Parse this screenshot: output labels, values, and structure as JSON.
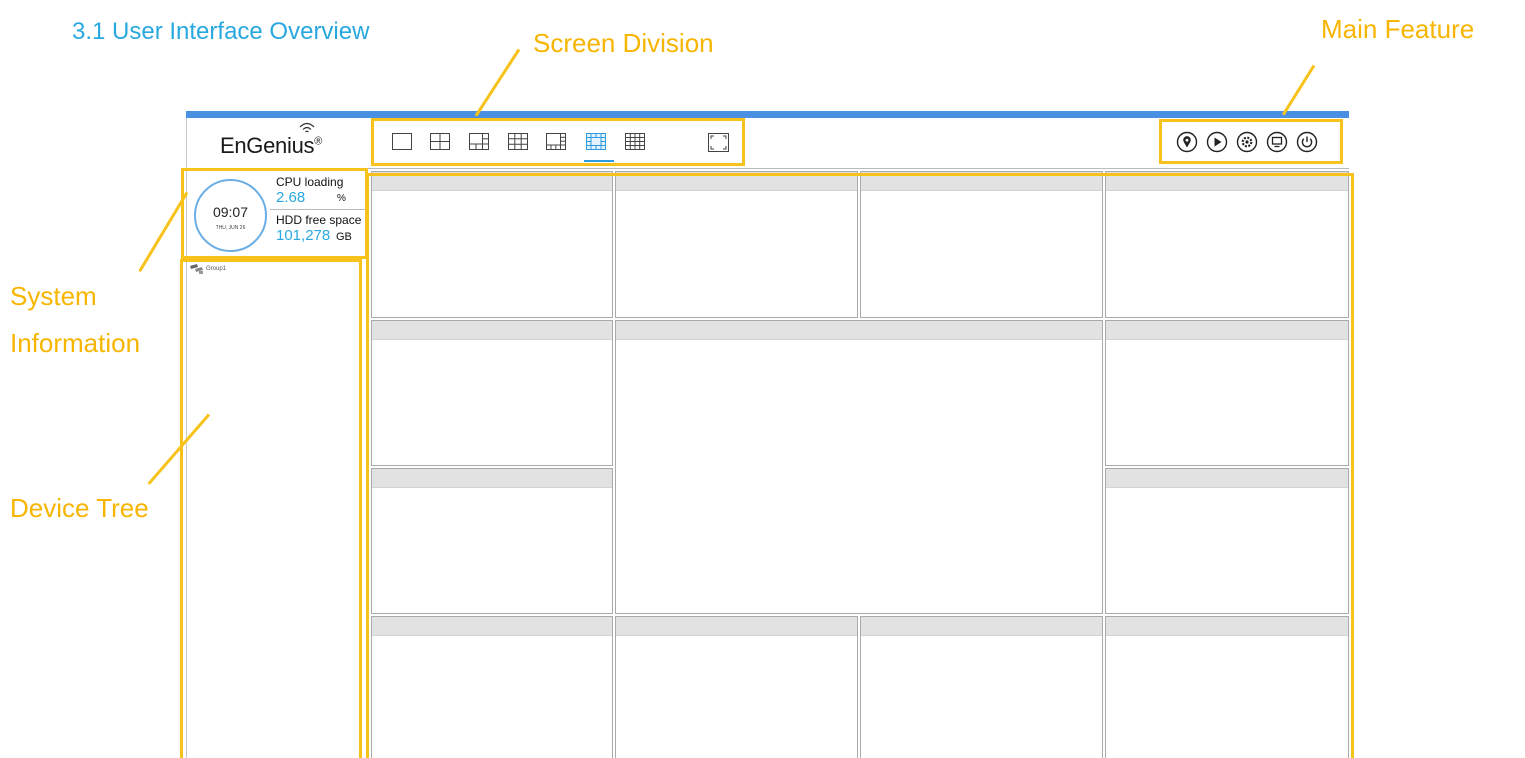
{
  "document": {
    "title": "3.1 User Interface Overview"
  },
  "annotations": {
    "screen_division": "Screen Division",
    "main_feature": "Main Feature",
    "system_information_line1": "System",
    "system_information_line2": "Information",
    "device_tree": "Device Tree",
    "highlight_color": "#f7c21a",
    "label_color": "#f7b500"
  },
  "app": {
    "brand": "EnGenius",
    "brand_mark": "®",
    "accent_color": "#4a90e2",
    "layout_buttons": [
      {
        "icon": "layout-1x1-icon",
        "selected": false
      },
      {
        "icon": "layout-2x2-icon",
        "selected": false
      },
      {
        "icon": "layout-1plus5-icon",
        "selected": false
      },
      {
        "icon": "layout-3x3-icon",
        "selected": false
      },
      {
        "icon": "layout-1plus7-icon",
        "selected": false
      },
      {
        "icon": "layout-1plus12-icon",
        "selected": true
      },
      {
        "icon": "layout-4x4-icon",
        "selected": false
      }
    ],
    "fullscreen_icon": "fullscreen-icon",
    "main_features": [
      "map-pin-icon",
      "playback-icon",
      "settings-icon",
      "monitor-icon",
      "power-icon"
    ],
    "system_info": {
      "time": "09:07",
      "date": "THU, JUN 26",
      "cpu_label": "CPU loading",
      "cpu_value": "2.68",
      "cpu_unit": "%",
      "hdd_label": "HDD free space",
      "hdd_value": "101,278",
      "hdd_unit": "GB",
      "value_color": "#29a8e0"
    },
    "device_tree": {
      "items": [
        {
          "label": "Group1",
          "icon": "camera-group-icon"
        }
      ]
    },
    "video_layout": "1+12",
    "video_tiles": 13
  }
}
